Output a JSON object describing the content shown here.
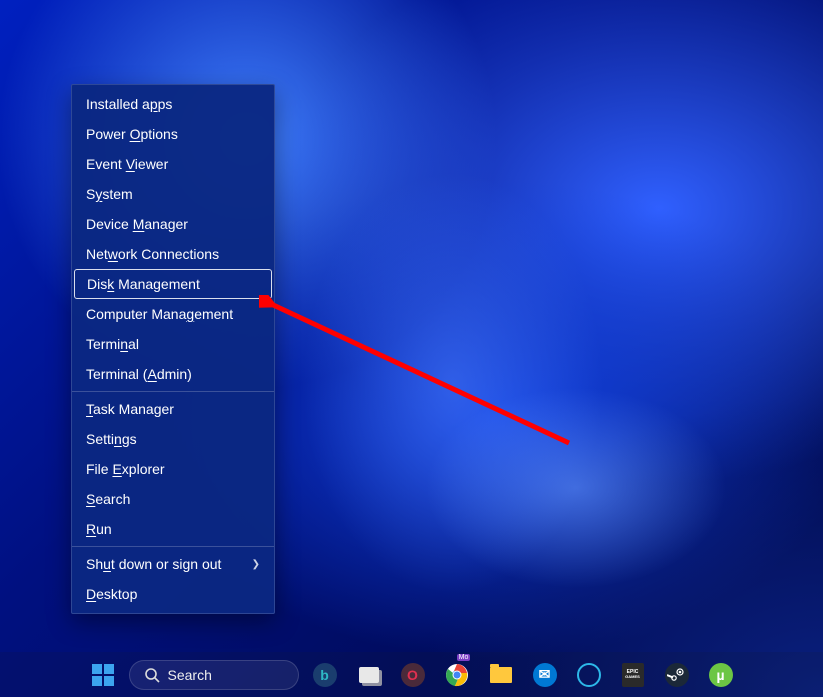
{
  "context_menu": {
    "items": [
      {
        "text_before": "Installed a",
        "hotkey": "p",
        "text_after": "ps"
      },
      {
        "text_before": "Power ",
        "hotkey": "O",
        "text_after": "ptions"
      },
      {
        "text_before": "Event ",
        "hotkey": "V",
        "text_after": "iewer"
      },
      {
        "text_before": "S",
        "hotkey": "y",
        "text_after": "stem"
      },
      {
        "text_before": "Device ",
        "hotkey": "M",
        "text_after": "anager"
      },
      {
        "text_before": "Net",
        "hotkey": "w",
        "text_after": "ork Connections"
      },
      {
        "text_before": "Dis",
        "hotkey": "k",
        "text_after": " Management",
        "highlighted": true
      },
      {
        "text_before": "Computer Mana",
        "hotkey": "g",
        "text_after": "ement"
      },
      {
        "text_before": "Termi",
        "hotkey": "n",
        "text_after": "al"
      },
      {
        "text_before": "Terminal (",
        "hotkey": "A",
        "text_after": "dmin)"
      },
      {
        "divider": true
      },
      {
        "text_before": "",
        "hotkey": "T",
        "text_after": "ask Manager"
      },
      {
        "text_before": "Setti",
        "hotkey": "n",
        "text_after": "gs"
      },
      {
        "text_before": "File ",
        "hotkey": "E",
        "text_after": "xplorer"
      },
      {
        "text_before": "",
        "hotkey": "S",
        "text_after": "earch"
      },
      {
        "text_before": "",
        "hotkey": "R",
        "text_after": "un"
      },
      {
        "divider": true
      },
      {
        "text_before": "Sh",
        "hotkey": "u",
        "text_after": "t down or sign out",
        "submenu": true
      },
      {
        "text_before": "",
        "hotkey": "D",
        "text_after": "esktop"
      }
    ]
  },
  "taskbar": {
    "search_placeholder": "Search",
    "icons": [
      {
        "name": "bing-icon",
        "bg": "#1a3d6e",
        "fg": "#2eb8c6",
        "glyph": "b"
      },
      {
        "name": "task-view-icon",
        "bg": "#e8e8e8"
      },
      {
        "name": "opera-icon",
        "bg": "#4a2a3a",
        "fg": "#e03050",
        "glyph": "O"
      },
      {
        "name": "chrome-icon",
        "bg": "#fff",
        "multi": true
      },
      {
        "name": "file-explorer-icon",
        "bg": "#ffc83d"
      },
      {
        "name": "mail-icon",
        "bg": "#0078d4",
        "fg": "#fff",
        "glyph": "✉"
      },
      {
        "name": "cortana-icon",
        "bg": "transparent",
        "fg": "#2db8e8",
        "glyph": "○"
      },
      {
        "name": "epic-games-icon",
        "bg": "#2a2a2a",
        "fg": "#fff",
        "glyph": "E"
      },
      {
        "name": "steam-icon",
        "bg": "#1b2838",
        "fg": "#fff",
        "glyph": "◐"
      },
      {
        "name": "utorrent-icon",
        "bg": "#6cc644",
        "fg": "#fff",
        "glyph": "µ"
      }
    ]
  }
}
